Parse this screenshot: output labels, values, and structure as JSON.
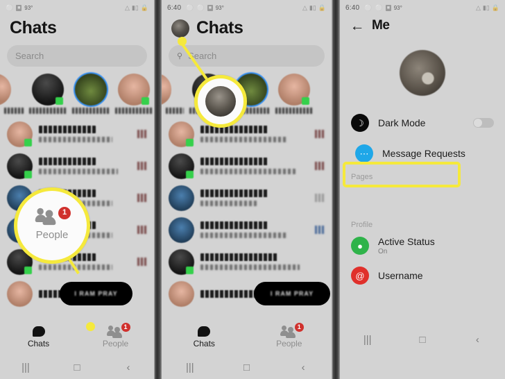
{
  "panels": {
    "left": {
      "status_bar": {
        "icons": [
          "mute-icon",
          "photo-icon"
        ],
        "temperature": "93°",
        "right_icons": [
          "wifi-icon",
          "signal-icon",
          "lock-icon"
        ]
      },
      "header_title": "Chats",
      "search_placeholder": "Search",
      "tabs": [
        {
          "label": "Chats",
          "icon": "chat-bubble-icon",
          "active": true,
          "badge": ""
        },
        {
          "label": "People",
          "icon": "people-icon",
          "active": false,
          "badge": "1"
        }
      ],
      "callout": {
        "label": "People",
        "badge": "1"
      },
      "redaction_text": "I RAM PRAY",
      "nav_icons": [
        "recents-icon",
        "home-icon",
        "back-icon"
      ]
    },
    "mid": {
      "status_bar": {
        "time": "6:40",
        "icons": [
          "mute-icon",
          "do-not-disturb-icon",
          "photo-icon"
        ],
        "temperature": "93°",
        "right_icons": [
          "wifi-icon",
          "signal-icon",
          "lock-icon"
        ]
      },
      "header_title": "Chats",
      "search_placeholder": "Search",
      "tabs": [
        {
          "label": "Chats",
          "icon": "chat-bubble-icon",
          "active": true,
          "badge": ""
        },
        {
          "label": "People",
          "icon": "people-icon",
          "active": false,
          "badge": "1"
        }
      ],
      "redaction_text": "I RAM PRAY",
      "nav_icons": [
        "recents-icon",
        "home-icon",
        "back-icon"
      ]
    },
    "right": {
      "status_bar": {
        "time": "6:40",
        "icons": [
          "mute-icon",
          "do-not-disturb-icon",
          "photo-icon"
        ],
        "temperature": "93°",
        "right_icons": [
          "wifi-icon",
          "signal-icon",
          "lock-icon"
        ]
      },
      "header_title": "Me",
      "back_icon": "arrow-left-icon",
      "settings": [
        {
          "label": "Dark Mode",
          "icon": "moon-icon",
          "icon_color": "#0a0a0a",
          "toggle": true,
          "toggle_on": false,
          "sub": ""
        },
        {
          "label": "Message Requests",
          "icon": "message-dots-icon",
          "icon_color": "#1fa7e8",
          "toggle": false,
          "toggle_on": false,
          "sub": "",
          "highlighted": true
        }
      ],
      "section_pages": "Pages",
      "section_profile": "Profile",
      "profile_items": [
        {
          "label": "Active Status",
          "sub": "On",
          "icon": "status-circle-icon",
          "icon_color": "#2fb34a"
        },
        {
          "label": "Username",
          "sub": "",
          "icon": "at-sign-icon",
          "icon_color": "#e0302b"
        }
      ],
      "nav_icons": [
        "recents-icon",
        "home-icon",
        "back-icon"
      ]
    }
  },
  "colors": {
    "highlight": "#f5e93c",
    "badge_red": "#d0312d",
    "panel_bg": "#d3d3d3",
    "divider": "#2f2f2f"
  }
}
